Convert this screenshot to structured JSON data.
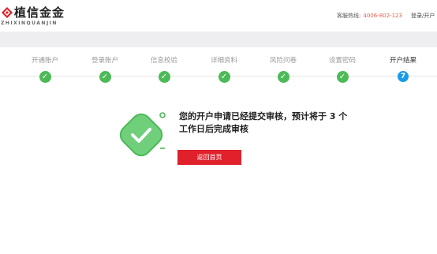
{
  "header": {
    "logo_text": "植信金金",
    "logo_sub": "ZHIXINQUANJIN",
    "hotline_label": "客服热线:",
    "hotline_number": "4006-802-123",
    "login_link": "登录/开户"
  },
  "steps": [
    {
      "label": "开通账户",
      "status": "done"
    },
    {
      "label": "登录账户",
      "status": "done"
    },
    {
      "label": "信息校验",
      "status": "done"
    },
    {
      "label": "详细资料",
      "status": "done"
    },
    {
      "label": "风险问卷",
      "status": "done"
    },
    {
      "label": "设置密码",
      "status": "done"
    },
    {
      "label": "开户结果",
      "status": "current",
      "number": "7"
    }
  ],
  "result": {
    "message": "您的开户申请已经提交审核，预计将于 3 个工作日后完成审核",
    "button_label": "返回首页"
  },
  "colors": {
    "brand_red": "#e0202b",
    "done_green": "#4cba57",
    "current_blue": "#1a9de6",
    "hotline_orange": "#e8604c"
  }
}
